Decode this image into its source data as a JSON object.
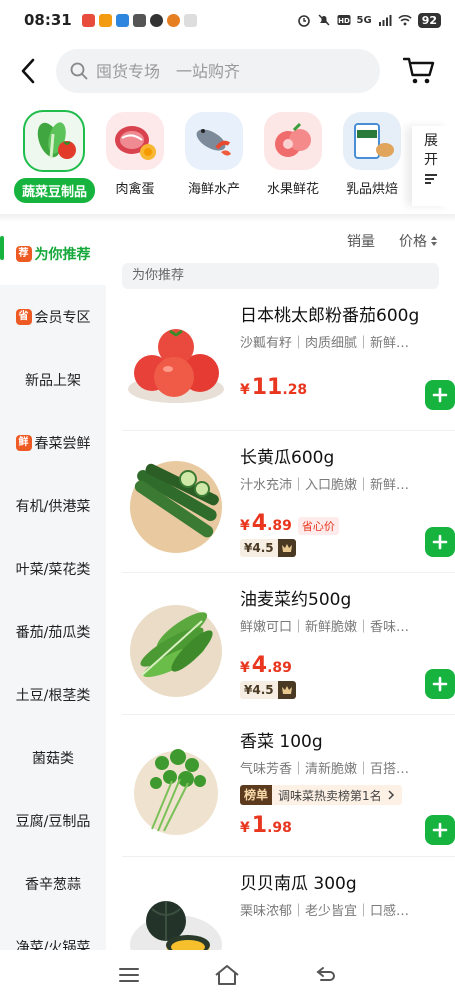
{
  "status_bar": {
    "time": "08:31",
    "network": "5G",
    "battery": "92",
    "app_icon_colors": [
      "#e74c3c",
      "#f39c12",
      "#2e86de",
      "#555555",
      "#333333",
      "#e67e22",
      "#cccccc"
    ]
  },
  "header": {
    "search_placeholder": "囤货专场　一站购齐"
  },
  "categories": [
    {
      "label": "蔬菜豆制品",
      "icon": "vegetables-icon",
      "active": true
    },
    {
      "label": "肉禽蛋",
      "icon": "meat-icon",
      "active": false
    },
    {
      "label": "海鲜水产",
      "icon": "seafood-icon",
      "active": false
    },
    {
      "label": "水果鲜花",
      "icon": "fruit-icon",
      "active": false
    },
    {
      "label": "乳品烘焙",
      "icon": "dairy-icon",
      "active": false
    }
  ],
  "expand": {
    "label_line1": "展",
    "label_line2": "开"
  },
  "sidebar": {
    "items": [
      {
        "label": "为你推荐",
        "badge": "荐",
        "active": true
      },
      {
        "label": "会员专区",
        "badge": "省",
        "active": false
      },
      {
        "label": "新品上架",
        "badge": "",
        "active": false
      },
      {
        "label": "春菜尝鲜",
        "badge": "鲜",
        "active": false
      },
      {
        "label": "有机/供港菜",
        "badge": "",
        "active": false
      },
      {
        "label": "叶菜/菜花类",
        "badge": "",
        "active": false
      },
      {
        "label": "番茄/茄瓜类",
        "badge": "",
        "active": false
      },
      {
        "label": "土豆/根茎类",
        "badge": "",
        "active": false
      },
      {
        "label": "菌菇类",
        "badge": "",
        "active": false
      },
      {
        "label": "豆腐/豆制品",
        "badge": "",
        "active": false
      },
      {
        "label": "香辛葱蒜",
        "badge": "",
        "active": false
      },
      {
        "label": "净菜/火锅菜",
        "badge": "",
        "active": false
      }
    ]
  },
  "sort": {
    "sales": "销量",
    "price": "价格"
  },
  "section_title": "为你推荐",
  "products": [
    {
      "name": "日本桃太郎粉番茄600g",
      "desc": "沙瓤有籽｜肉质细腻｜新鲜…",
      "currency": "¥",
      "price_int": "11",
      "price_dec": ".28"
    },
    {
      "name": "长黄瓜600g",
      "desc": "汁水充沛｜入口脆嫩｜新鲜…",
      "currency": "¥",
      "price_int": "4",
      "price_dec": ".89",
      "save_tag": "省心价",
      "vip_price": "¥4.5"
    },
    {
      "name": "油麦菜约500g",
      "desc": "鲜嫩可口｜新鲜脆嫩｜香味…",
      "currency": "¥",
      "price_int": "4",
      "price_dec": ".89",
      "vip_price": "¥4.5"
    },
    {
      "name": "香菜  100g",
      "desc": "气味芳香｜清新脆嫩｜百搭…",
      "currency": "¥",
      "price_int": "1",
      "price_dec": ".98",
      "rank_badge": "榜单",
      "rank_text": "调味菜热卖榜第1名"
    },
    {
      "name": "贝贝南瓜  300g",
      "desc": "栗味浓郁｜老少皆宜｜口感…"
    }
  ],
  "colors": {
    "accent_green": "#16b43f",
    "price_red": "#e8361f",
    "vip_brown": "#4a3a23"
  }
}
